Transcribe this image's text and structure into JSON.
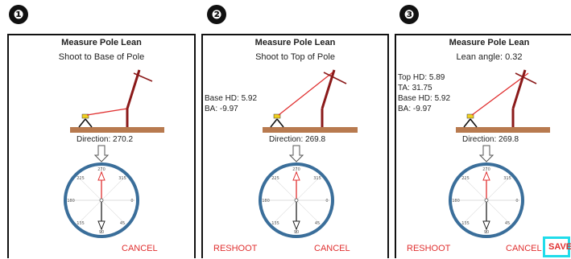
{
  "steps": [
    "❶",
    "❷",
    "❸"
  ],
  "screens": [
    {
      "title": "Measure Pole Lean",
      "subtitle": "Shoot to Base of Pole",
      "info": [],
      "direction": "Direction: 270.2",
      "buttons": {
        "reshoot": "",
        "cancel": "CANCEL",
        "save": ""
      }
    },
    {
      "title": "Measure Pole Lean",
      "subtitle": "Shoot to Top of Pole",
      "info": [
        "Base HD: 5.92",
        "BA: -9.97"
      ],
      "direction": "Direction: 269.8",
      "buttons": {
        "reshoot": "RESHOOT",
        "cancel": "CANCEL",
        "save": ""
      }
    },
    {
      "title": "Measure Pole Lean",
      "subtitle": "Lean angle: 0.32",
      "info": [
        "Top HD: 5.89",
        "TA: 31.75",
        "Base HD: 5.92",
        "BA: -9.97"
      ],
      "direction": "Direction: 269.8",
      "buttons": {
        "reshoot": "RESHOOT",
        "cancel": "CANCEL",
        "save": "SAVE"
      }
    }
  ],
  "compass_labels": {
    "n": "270",
    "ne": "315",
    "e": "0",
    "se": "45",
    "s": "90",
    "sw": "135",
    "w": "180",
    "nw": "225"
  },
  "colors": {
    "accent": "#e03030",
    "pole": "#8b1a1a",
    "ground": "#b87a4f",
    "compass_ring": "#3a6e9a",
    "save_highlight": "#20dcea"
  }
}
